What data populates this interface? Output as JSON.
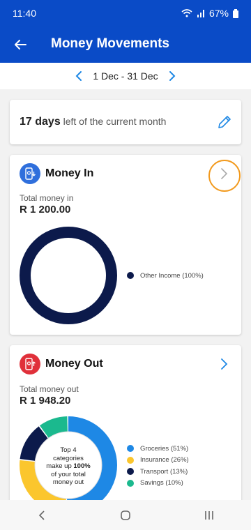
{
  "status": {
    "time": "11:40",
    "battery": "67%"
  },
  "header": {
    "title": "Money Movements"
  },
  "date_range": {
    "label": "1 Dec - 31 Dec"
  },
  "days_left": {
    "count": "17 days",
    "suffix": "left of the current month"
  },
  "money_in": {
    "title": "Money In",
    "total_label": "Total money in",
    "total_value": "R 1 200.00",
    "categories": [
      {
        "label": "Other Income (100%)",
        "percent": 100,
        "color": "#0c1a4b"
      }
    ]
  },
  "money_out": {
    "title": "Money Out",
    "total_label": "Total money out",
    "total_value": "R 1 948.20",
    "center_text": {
      "line1": "Top 4",
      "line2": "categories",
      "line3a": "make up ",
      "line3b": "100%",
      "line4": "of your total",
      "line5": "money out"
    },
    "categories": [
      {
        "label": "Groceries (51%)",
        "percent": 51,
        "color": "#1e88e5"
      },
      {
        "label": "Insurance (26%)",
        "percent": 26,
        "color": "#fbc62d"
      },
      {
        "label": "Transport (13%)",
        "percent": 13,
        "color": "#0c1a4b"
      },
      {
        "label": "Savings (10%)",
        "percent": 10,
        "color": "#1bb98e"
      }
    ]
  },
  "colors": {
    "brand": "#0a4bc7",
    "accent": "#1e88e5",
    "highlight": "#f29a1e"
  }
}
